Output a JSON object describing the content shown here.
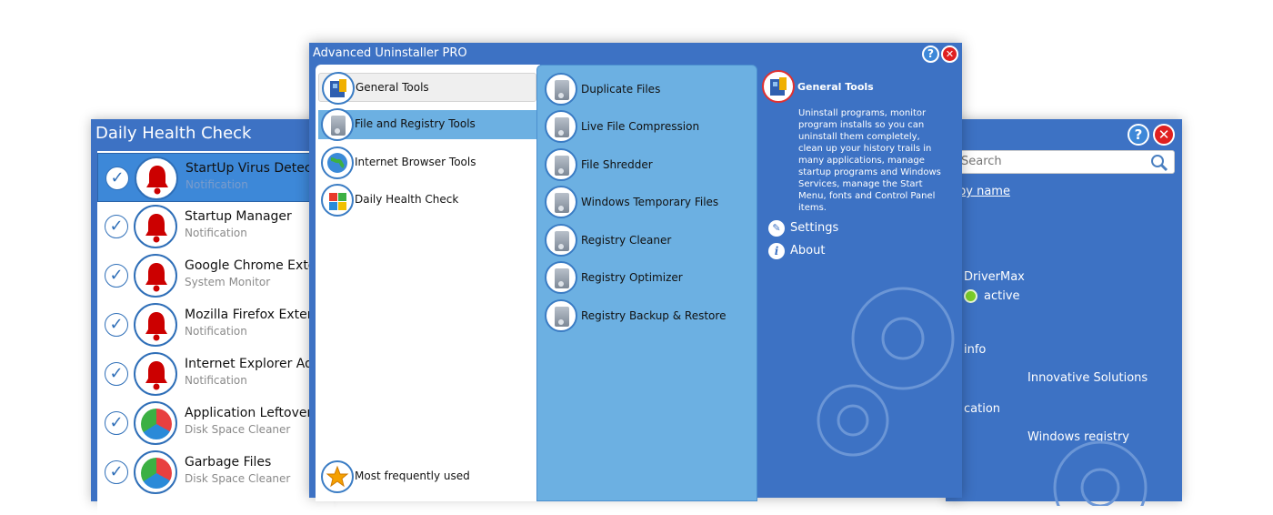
{
  "left_window": {
    "title": "Daily Health Check",
    "items": [
      {
        "name": "StartUp Virus Detection",
        "sub": "Notification",
        "icon": "bell-icon",
        "selected": true
      },
      {
        "name": "Startup Manager",
        "sub": "Notification",
        "icon": "bell-icon"
      },
      {
        "name": "Google Chrome Extensions",
        "sub": "System Monitor",
        "icon": "bell-icon"
      },
      {
        "name": "Mozilla Firefox Extensions",
        "sub": "Notification",
        "icon": "bell-icon"
      },
      {
        "name": "Internet Explorer Add-ons",
        "sub": "Notification",
        "icon": "bell-icon"
      },
      {
        "name": "Application Leftover Files",
        "sub": "Disk Space Cleaner",
        "icon": "pie-chart-icon"
      },
      {
        "name": "Garbage Files",
        "sub": "Disk Space Cleaner",
        "icon": "pie-chart-icon"
      }
    ]
  },
  "right_window": {
    "search_placeholder": "Search",
    "sort_link": "by name",
    "app_name": "DriverMax",
    "status": "active",
    "info_label": "info",
    "publisher": "Innovative Solutions",
    "location_label": "cation",
    "location_value": "Windows registry",
    "help_label": "?",
    "close_label": "✕"
  },
  "main_window": {
    "title": "Advanced Uninstaller PRO",
    "help_label": "?",
    "close_label": "✕",
    "nav": [
      {
        "label": "General Tools",
        "icon": "general-tools-icon"
      },
      {
        "label": "File and Registry Tools",
        "icon": "file-registry-icon"
      },
      {
        "label": "Internet Browser Tools",
        "icon": "browser-globe-icon"
      },
      {
        "label": "Daily Health Check",
        "icon": "health-check-icon"
      }
    ],
    "most_used_label": "Most frequently used",
    "tools": [
      {
        "label": "Duplicate Files"
      },
      {
        "label": "Live File Compression"
      },
      {
        "label": "File Shredder"
      },
      {
        "label": "Windows Temporary Files"
      },
      {
        "label": "Registry Cleaner"
      },
      {
        "label": "Registry Optimizer"
      },
      {
        "label": "Registry Backup & Restore"
      }
    ],
    "panel": {
      "heading": "General Tools",
      "description": "Uninstall programs, monitor program installs so you can uninstall them completely, clean up your history trails in many applications, manage startup programs and Windows Services, manage the Start Menu, fonts and Control Panel items.",
      "settings_label": "Settings",
      "about_label": "About"
    }
  },
  "colors": {
    "accent": "#3d72c4",
    "tool_column": "#6cb0e2",
    "bell": "#cc0000",
    "status_green": "#7ccf2a"
  }
}
